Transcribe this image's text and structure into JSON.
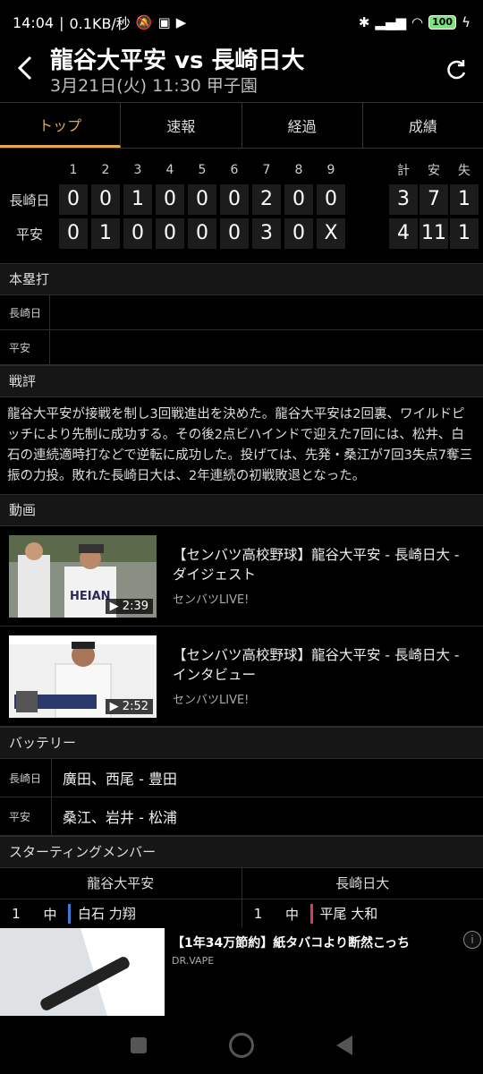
{
  "statusbar": {
    "time": "14:04",
    "speed": "0.1KB/秒",
    "battery": "100"
  },
  "header": {
    "title": "龍谷大平安 vs 長崎日大",
    "subtitle": "3月21日(火) 11:30 甲子園"
  },
  "tabs": [
    "トップ",
    "速報",
    "経過",
    "成績"
  ],
  "scoreboard": {
    "innings": [
      "1",
      "2",
      "3",
      "4",
      "5",
      "6",
      "7",
      "8",
      "9"
    ],
    "totals_labels": [
      "計",
      "安",
      "失"
    ],
    "rows": [
      {
        "team": "長崎日",
        "scores": [
          "0",
          "0",
          "1",
          "0",
          "0",
          "0",
          "2",
          "0",
          "0"
        ],
        "totals": [
          "3",
          "7",
          "1"
        ]
      },
      {
        "team": "平安",
        "scores": [
          "0",
          "1",
          "0",
          "0",
          "0",
          "0",
          "3",
          "0",
          "X"
        ],
        "totals": [
          "4",
          "11",
          "1"
        ]
      }
    ]
  },
  "homerun": {
    "header": "本塁打",
    "teams": [
      "長崎日",
      "平安"
    ]
  },
  "review": {
    "header": "戦評",
    "text": "龍谷大平安が接戦を制し3回戦進出を決めた。龍谷大平安は2回裏、ワイルドピッチにより先制に成功する。その後2点ビハインドで迎えた7回には、松井、白石の連続適時打などで逆転に成功した。投げては、先発・桑江が7回3失点7奪三振の力投。敗れた長崎日大は、2年連続の初戦敗退となった。"
  },
  "videos": {
    "header": "動画",
    "items": [
      {
        "title": "【センバツ高校野球】龍谷大平安 - 長崎日大 - ダイジェスト",
        "source": "センバツLIVE!",
        "duration": "2:39"
      },
      {
        "title": "【センバツ高校野球】龍谷大平安 - 長崎日大 - インタビュー",
        "source": "センバツLIVE!",
        "duration": "2:52"
      }
    ]
  },
  "battery": {
    "header": "バッテリー",
    "rows": [
      {
        "team": "長崎日",
        "names": "廣田、西尾 - 豊田"
      },
      {
        "team": "平安",
        "names": "桑江、岩井 - 松浦"
      }
    ]
  },
  "lineup": {
    "header": "スターティングメンバー",
    "teams": [
      "龍谷大平安",
      "長崎日大"
    ],
    "rows": [
      {
        "left": {
          "num": "1",
          "pos": "中",
          "name": "白石 力翔"
        },
        "right": {
          "num": "1",
          "pos": "中",
          "name": "平尾 大和"
        }
      }
    ]
  },
  "ad": {
    "title": "【1年34万節約】紙タバコより断然こっち",
    "source": "DR.VAPE"
  },
  "colors": {
    "accent": "#e0a855",
    "home_bar": "#3a7bd5",
    "away_bar": "#d23a6a"
  }
}
